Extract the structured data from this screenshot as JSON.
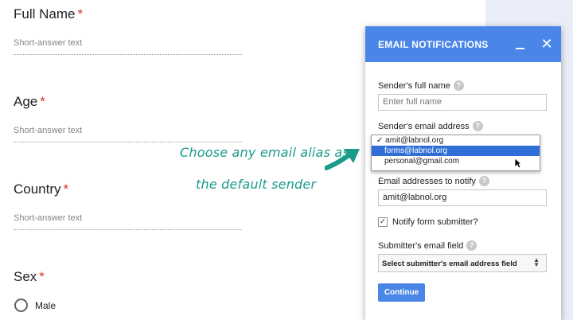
{
  "form": {
    "questions": [
      {
        "title": "Full Name",
        "required_mark": "*",
        "placeholder": "Short-answer text"
      },
      {
        "title": "Age",
        "required_mark": "*",
        "placeholder": "Short-answer text"
      },
      {
        "title": "Country",
        "required_mark": "*",
        "placeholder": "Short-answer text"
      },
      {
        "title": "Sex",
        "required_mark": "*"
      }
    ],
    "sex_option": "Male"
  },
  "annotation": {
    "line1": "Choose any email alias as",
    "line2": "the default sender",
    "color": "#1a9b8a"
  },
  "dialog": {
    "title": "EMAIL NOTIFICATIONS",
    "header_color": "#4a86e8",
    "minimize_icon": "minimize-icon",
    "close_icon": "close-icon",
    "close_glyph": "✕",
    "help_glyph": "?",
    "sender_name_label": "Sender's full name",
    "sender_name_placeholder": "Enter full name",
    "sender_email_label": "Sender's email address",
    "email_options": [
      {
        "label": "amit@labnol.org",
        "check": "✓"
      },
      {
        "label": "forms@labnol.org",
        "highlighted": true
      },
      {
        "label": "personal@gmail.com"
      }
    ],
    "notify_label": "Email addresses to notify",
    "notify_value": "amit@labnol.org",
    "notify_submitter_label": "Notify form submitter?",
    "notify_submitter_checked": true,
    "submitter_field_label": "Submitter's email field",
    "submitter_field_value": "Select submitter's email address field",
    "continue_label": "Continue"
  }
}
